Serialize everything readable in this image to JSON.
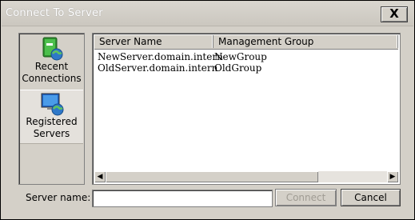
{
  "window": {
    "title": "Connect To Server",
    "close_label": "X"
  },
  "sidebar": {
    "items": [
      {
        "label": "Recent Connections",
        "icon": "recent-book-icon",
        "selected": false
      },
      {
        "label": "Registered Servers",
        "icon": "monitor-globe-icon",
        "selected": true
      }
    ]
  },
  "list": {
    "columns": [
      "Server Name",
      "Management Group"
    ],
    "rows": [
      [
        "NewServer.domain.intern",
        "NewGroup"
      ],
      [
        "OldServer.domain.intern",
        "OldGroup"
      ]
    ]
  },
  "form": {
    "server_name_label": "Server name:",
    "server_name_value": "",
    "connect_label": "Connect",
    "cancel_label": "Cancel"
  },
  "colors": {
    "dialog_bg": "#d4d0c8",
    "list_bg": "#ffffff"
  }
}
